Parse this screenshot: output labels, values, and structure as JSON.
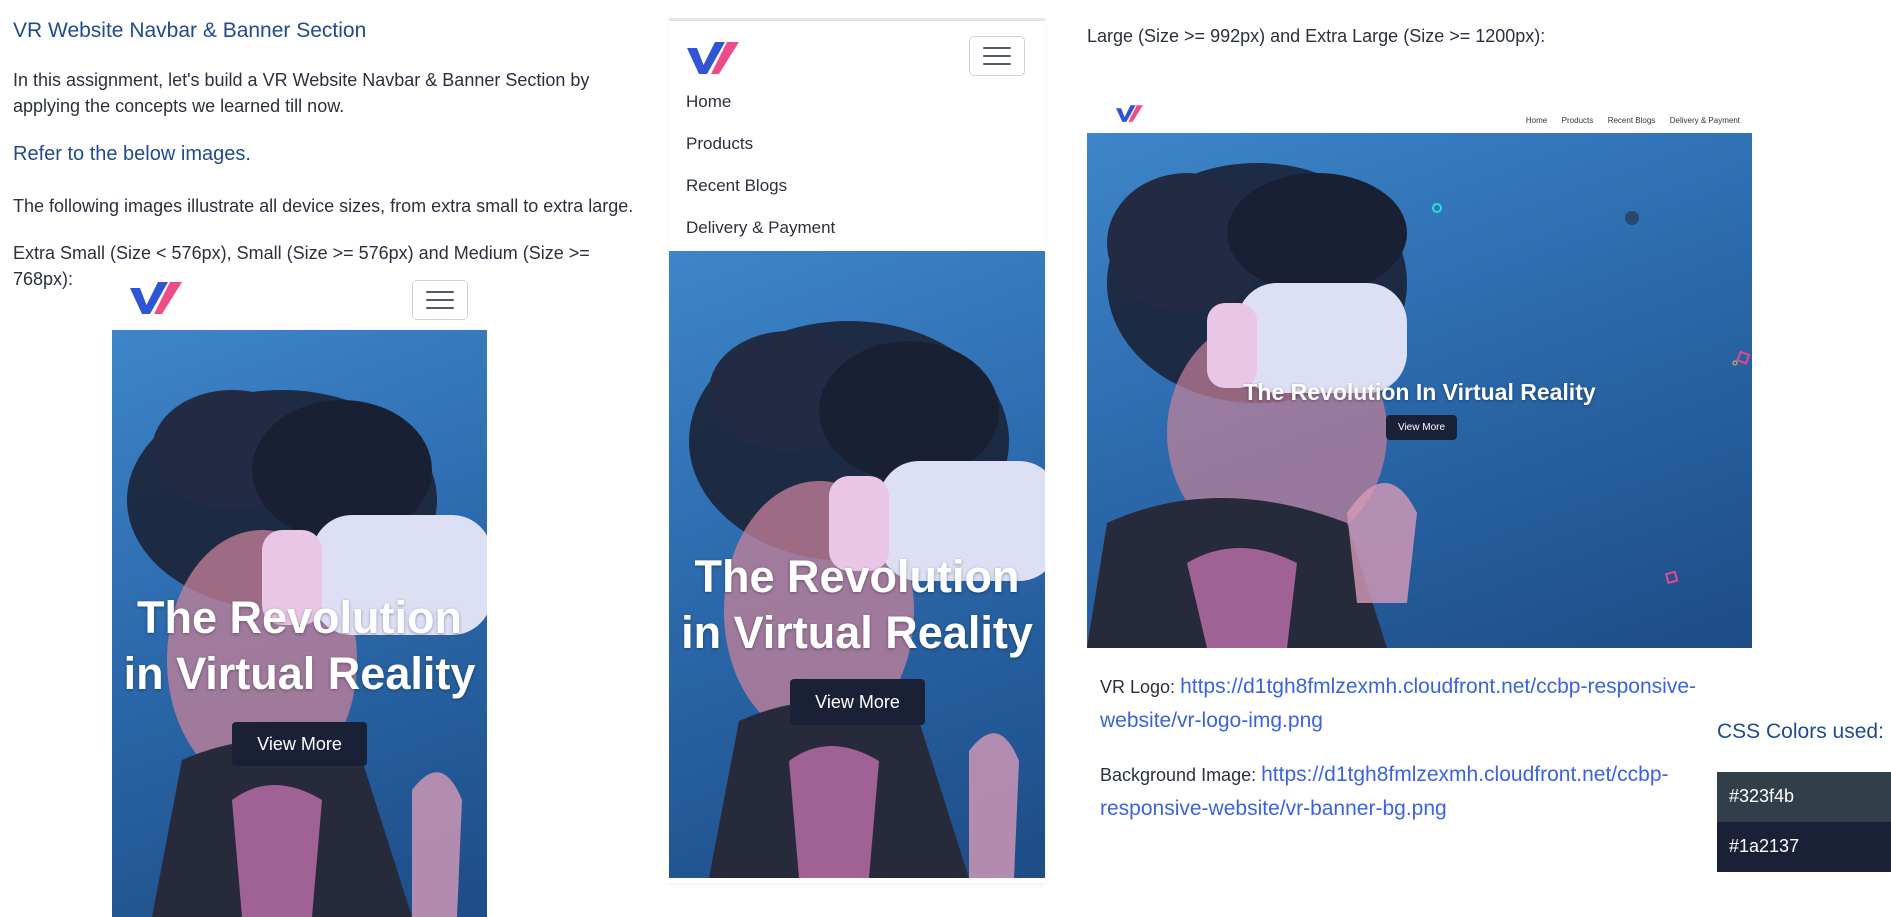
{
  "intro": {
    "title": "VR Website Navbar & Banner Section",
    "description": "In this assignment, let's build a VR Website Navbar & Banner Section by applying the concepts we learned till now.",
    "refer_heading": "Refer to the below images.",
    "devices_text": "The following images illustrate all device sizes, from extra small to extra large.",
    "small_sizes_label": "Extra Small (Size < 576px), Small (Size >= 576px) and Medium (Size >= 768px):"
  },
  "mockup_menu": {
    "items": [
      "Home",
      "Products",
      "Recent Blogs",
      "Delivery & Payment"
    ]
  },
  "banner": {
    "heading": "The Revolution in Virtual Reality",
    "button_label": "View More"
  },
  "large": {
    "label": "Large (Size >= 992px) and Extra Large (Size >= 1200px):",
    "nav_links": [
      "Home",
      "Products",
      "Recent Blogs",
      "Delivery & Payment"
    ],
    "heading": "The Revolution In Virtual Reality"
  },
  "resources": {
    "logo_label": "VR Logo:",
    "logo_url": "https://d1tgh8fmlzexmh.cloudfront.net/ccbp-responsive-website/vr-logo-img.png",
    "bg_label": "Background Image:",
    "bg_url": "https://d1tgh8fmlzexmh.cloudfront.net/ccbp-responsive-website/vr-banner-bg.png"
  },
  "css_colors": {
    "title": "CSS Colors used:",
    "colors": [
      "#323f4b",
      "#1a2137"
    ]
  }
}
